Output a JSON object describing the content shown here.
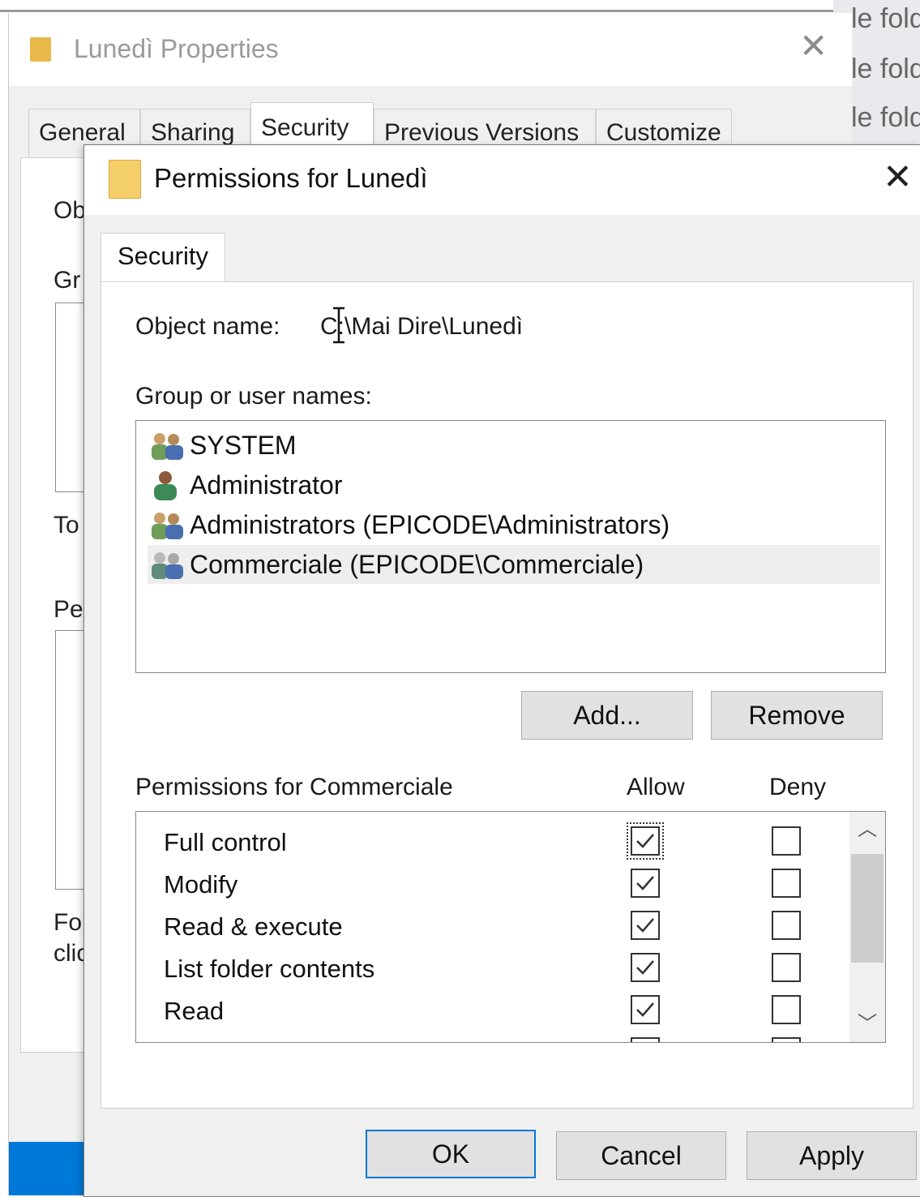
{
  "background": {
    "explorer_rows": [
      "le fold",
      "le fold",
      "le fold"
    ]
  },
  "properties": {
    "title": "Lunedì Properties",
    "tabs": [
      "General",
      "Sharing",
      "Security",
      "Previous Versions",
      "Customize"
    ],
    "active_tab": "Security",
    "peek_labels": [
      "Ob",
      "Gr",
      "To",
      "Pe",
      "Fo",
      "clic"
    ]
  },
  "dialog": {
    "title": "Permissions for Lunedì",
    "close_label": "✕",
    "tab": "Security",
    "object_name_label": "Object name:",
    "object_name_value": "C:\\Mai Dire\\Lunedì",
    "group_label": "Group or user names:",
    "users": [
      {
        "label": "SYSTEM",
        "icon": "group-icon"
      },
      {
        "label": "Administrator",
        "icon": "user-icon"
      },
      {
        "label": "Administrators (EPICODE\\Administrators)",
        "icon": "group-icon"
      },
      {
        "label": "Commerciale (EPICODE\\Commerciale)",
        "icon": "group-icon",
        "selected": true
      }
    ],
    "add_button": "Add...",
    "remove_button": "Remove",
    "permissions_label": "Permissions for Commerciale",
    "allow_header": "Allow",
    "deny_header": "Deny",
    "permissions": [
      {
        "name": "Full control",
        "allow": true,
        "deny": false
      },
      {
        "name": "Modify",
        "allow": true,
        "deny": false
      },
      {
        "name": "Read & execute",
        "allow": true,
        "deny": false
      },
      {
        "name": "List folder contents",
        "allow": true,
        "deny": false
      },
      {
        "name": "Read",
        "allow": true,
        "deny": false
      }
    ],
    "ok_button": "OK",
    "cancel_button": "Cancel",
    "apply_button": "Apply"
  },
  "colors": {
    "accent": "#0078d7",
    "folder": "#f5cf6a"
  }
}
